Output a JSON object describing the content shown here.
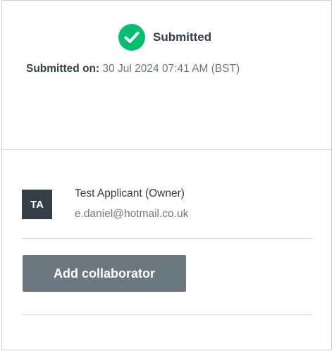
{
  "status": {
    "icon": "check-circle-icon",
    "label": "Submitted",
    "color": "#00bf6f"
  },
  "submission": {
    "label": "Submitted on:",
    "value": "30 Jul 2024 07:41 AM (BST)"
  },
  "owner": {
    "initials": "TA",
    "name": "Test Applicant (Owner)",
    "email": "e.daniel@hotmail.co.uk"
  },
  "actions": {
    "add_collaborator_label": "Add collaborator"
  },
  "colors": {
    "accent_green": "#00bf6f",
    "avatar_bg": "#333e48",
    "button_bg": "#6b787f"
  }
}
